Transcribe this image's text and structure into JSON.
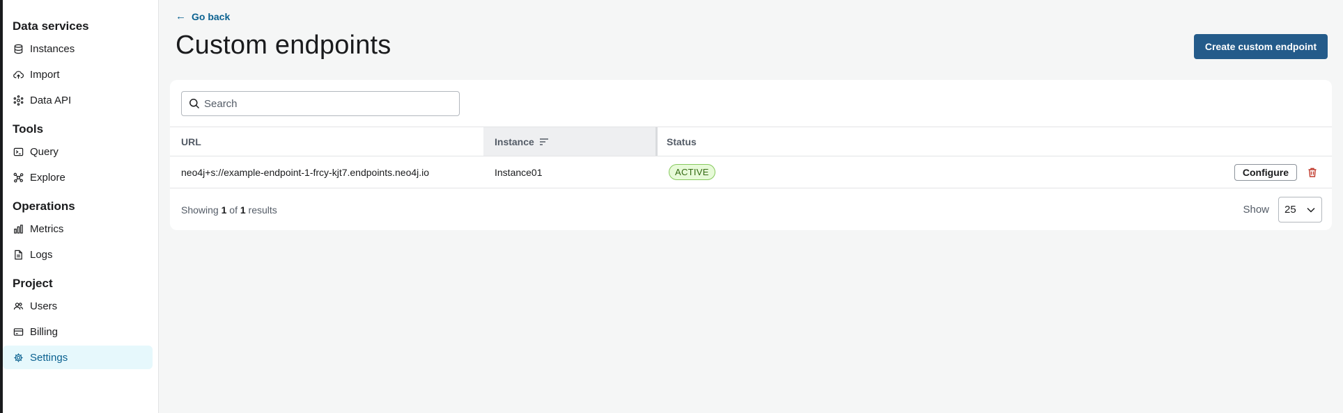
{
  "sidebar": {
    "sections": [
      {
        "title": "Data services",
        "items": [
          {
            "label": "Instances",
            "icon": "database-icon"
          },
          {
            "label": "Import",
            "icon": "cloud-upload-icon"
          },
          {
            "label": "Data API",
            "icon": "data-api-icon"
          }
        ]
      },
      {
        "title": "Tools",
        "items": [
          {
            "label": "Query",
            "icon": "terminal-icon"
          },
          {
            "label": "Explore",
            "icon": "graph-icon"
          }
        ]
      },
      {
        "title": "Operations",
        "items": [
          {
            "label": "Metrics",
            "icon": "bar-chart-icon"
          },
          {
            "label": "Logs",
            "icon": "document-icon"
          }
        ]
      },
      {
        "title": "Project",
        "items": [
          {
            "label": "Users",
            "icon": "users-icon"
          },
          {
            "label": "Billing",
            "icon": "credit-card-icon"
          },
          {
            "label": "Settings",
            "icon": "gear-icon",
            "active": true
          }
        ]
      }
    ]
  },
  "header": {
    "go_back": "Go back",
    "title": "Custom endpoints",
    "create_button": "Create custom endpoint"
  },
  "search": {
    "placeholder": "Search",
    "value": ""
  },
  "table": {
    "columns": [
      "URL",
      "Instance",
      "Status"
    ],
    "rows": [
      {
        "url": "neo4j+s://example-endpoint-1-frcy-kjt7.endpoints.neo4j.io",
        "instance": "Instance01",
        "status": "ACTIVE",
        "action": "Configure"
      }
    ]
  },
  "footer": {
    "showing_prefix": "Showing",
    "shown": "1",
    "of": "of",
    "total": "1",
    "results": "results",
    "show_label": "Show",
    "page_size": "25"
  },
  "colors": {
    "primary": "#245b8a",
    "link": "#0a6190",
    "active_bg": "#e6f8fc",
    "badge_bg": "#e7fad8",
    "badge_text": "#336a12",
    "danger": "#c0392b"
  }
}
